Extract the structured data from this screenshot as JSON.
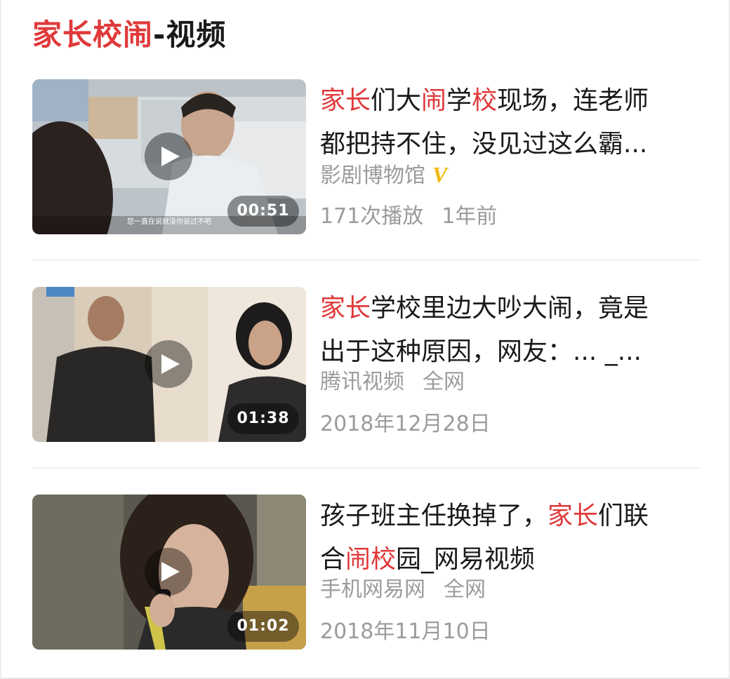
{
  "section": {
    "title_highlight": "家长校闹",
    "title_rest": "-视频"
  },
  "videos": [
    {
      "title_segments": [
        [
          {
            "text": "家长",
            "hl": true
          },
          {
            "text": "们大",
            "hl": false
          },
          {
            "text": "闹",
            "hl": true
          },
          {
            "text": "学",
            "hl": false
          },
          {
            "text": "校",
            "hl": true
          },
          {
            "text": "现场，连老师",
            "hl": false
          }
        ],
        [
          {
            "text": "都把持不住，没见过这么霸...",
            "hl": false
          }
        ]
      ],
      "source": "影剧博物馆",
      "verified_badge": "V",
      "scope": "",
      "plays": "171次播放",
      "date": "1年前",
      "duration": "00:51",
      "subtitle_overlay": "您一直在说就没你说过不吧",
      "thumb_colors": {
        "bg": "#b9c2c8",
        "accent": "#d9dee2",
        "figure": "#3a3431"
      }
    },
    {
      "title_segments": [
        [
          {
            "text": "家长",
            "hl": true
          },
          {
            "text": "学校里边大吵大闹，竟是",
            "hl": false
          }
        ],
        [
          {
            "text": "出于这种原因，网友：... _...",
            "hl": false
          }
        ]
      ],
      "source": "腾讯视频",
      "verified_badge": "",
      "scope": "全网",
      "plays": "",
      "date": "2018年12月28日",
      "duration": "01:38",
      "subtitle_overlay": "",
      "thumb_colors": {
        "bg": "#d8cbb8",
        "accent": "#eee6d9",
        "figure": "#2c2a2a"
      }
    },
    {
      "title_segments": [
        [
          {
            "text": "孩子班主任换掉了，",
            "hl": false
          },
          {
            "text": "家长",
            "hl": true
          },
          {
            "text": "们联",
            "hl": false
          }
        ],
        [
          {
            "text": "合",
            "hl": false
          },
          {
            "text": "闹校",
            "hl": true
          },
          {
            "text": "园_网易视频",
            "hl": false
          }
        ]
      ],
      "source": "手机网易网",
      "verified_badge": "",
      "scope": "全网",
      "plays": "",
      "date": "2018年11月10日",
      "duration": "01:02",
      "subtitle_overlay": "",
      "thumb_colors": {
        "bg": "#5e5a50",
        "accent": "#8f8a7a",
        "figure": "#2e2620"
      }
    }
  ],
  "colors": {
    "highlight": "#e0393a",
    "meta_text": "#9b9b9b",
    "verified_badge": "#f0b90f"
  },
  "icons": {
    "play": "play-icon",
    "verified": "verified-v-badge"
  }
}
